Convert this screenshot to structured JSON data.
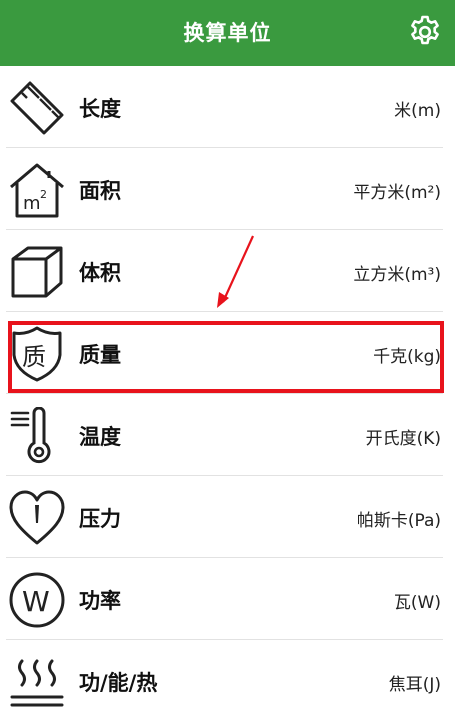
{
  "header": {
    "title": "换算单位"
  },
  "items": [
    {
      "icon": "ruler-icon",
      "name": "长度",
      "unit": "米(m)"
    },
    {
      "icon": "house-area-icon",
      "name": "面积",
      "unit": "平方米(m²)"
    },
    {
      "icon": "cube-icon",
      "name": "体积",
      "unit": "立方米(m³)"
    },
    {
      "icon": "shield-mass-icon",
      "name": "质量",
      "unit": "千克(kg)"
    },
    {
      "icon": "thermometer-icon",
      "name": "温度",
      "unit": "开氏度(K)"
    },
    {
      "icon": "heart-gauge-icon",
      "name": "压力",
      "unit": "帕斯卡(Pa)"
    },
    {
      "icon": "watt-circle-icon",
      "name": "功率",
      "unit": "瓦(W)"
    },
    {
      "icon": "heat-waves-icon",
      "name": "功/能/热",
      "unit": "焦耳(J)"
    }
  ],
  "icon_text": {
    "area": "m",
    "area_sup": "2",
    "mass": "质",
    "power": "W"
  },
  "colors": {
    "header": "#3a9a3f",
    "highlight": "#e8131c"
  }
}
